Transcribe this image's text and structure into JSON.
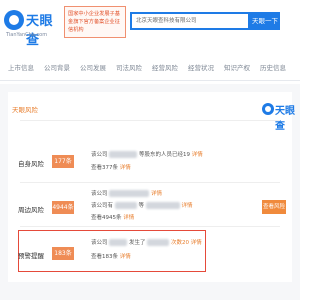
{
  "header": {
    "logo_text": "天眼查",
    "logo_subtext": "TianYanCha.com",
    "promo_text": "国家中小企业发展子基金旗下官方备案企业征信机构",
    "search_value": "北京天眼查科技有限公司",
    "search_button": "天眼一下"
  },
  "tabs": [
    "上市信息",
    "公司背景",
    "公司发展",
    "司法风险",
    "经营风险",
    "经营状况",
    "知识产权",
    "历史信息"
  ],
  "risk": {
    "title": "天眼风险",
    "brand_text": "天眼查",
    "rows": [
      {
        "label": "自身风险",
        "badge": "177条",
        "lines": [
          {
            "prefix": "该公司",
            "mid": "等股东的人员已经19",
            "suffix": "详情"
          },
          {
            "prefix": "查看377条",
            "mid": "",
            "suffix": "详情"
          }
        ]
      },
      {
        "label": "周边风险",
        "badge": "4944条",
        "lines": [
          {
            "prefix": "该公司",
            "mid": "",
            "suffix": "详情"
          },
          {
            "prefix": "该公司有",
            "mid": "等",
            "suffix": "详情"
          },
          {
            "prefix": "查看4945条",
            "mid": "",
            "suffix": "详情"
          }
        ]
      },
      {
        "label": "预警提醒",
        "badge": "183条",
        "lines": [
          {
            "prefix": "该公司",
            "mid": "发生了",
            "suffix": "次数20 详情"
          },
          {
            "prefix": "查看183条",
            "mid": "",
            "suffix": "详情"
          }
        ]
      }
    ],
    "action_button": "查看风险"
  },
  "colors": {
    "brand_blue": "#1e7be6",
    "accent_orange": "#ef8c55",
    "highlight_red": "#e54a3a"
  }
}
